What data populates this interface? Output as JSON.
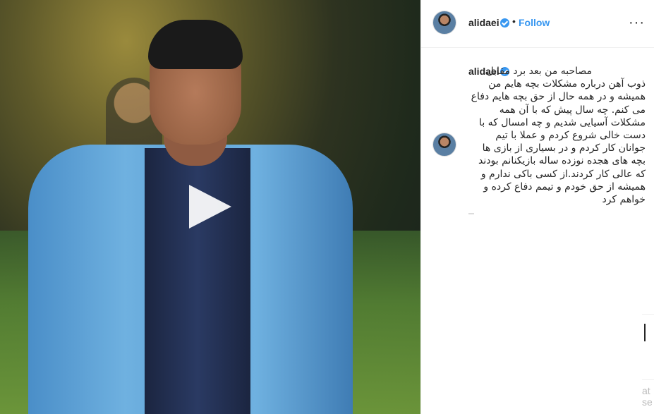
{
  "post": {
    "username": "alidaei",
    "dot": "•",
    "follow_label": "Follow",
    "more_icon": "···"
  },
  "caption": {
    "username": "alidaei",
    "text": "مصاحبه من بعد برد مقابل ذوب آهن درباره مشکلات بچه هایم من همیشه و در همه حال از حق بچه هایم دفاع می کنم. چه سال پیش که با آن همه مشکلات آسیایی شدیم و چه امسال که با دست خالی شروع کردم و عملا با تیم جوانان کار کردم و در بسیاری از بازی ها بچه های هجده نوزده ساله بازیکنانم بودند که عالی کار کردند.از کسی باکی ندارم و همیشه از حق خودم و تیمم دفاع کرده و خواهم کرد"
  },
  "edge": {
    "text": "at\nse"
  },
  "colors": {
    "accent": "#3897f0",
    "text": "#262626",
    "border": "#efefef"
  },
  "icons": {
    "play": "play-icon",
    "verified": "verified-badge-icon",
    "more": "more-options-icon"
  }
}
